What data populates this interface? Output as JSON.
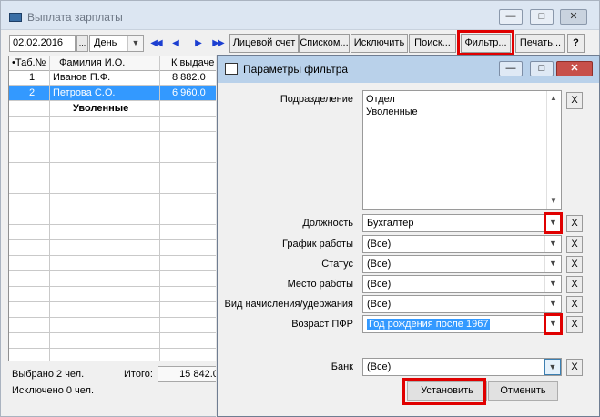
{
  "main_window": {
    "title": "Выплата зарплаты",
    "caption": {
      "minimize": "—",
      "maximize": "□",
      "close": "✕"
    },
    "toolbar": {
      "date_value": "02.02.2016",
      "ellipsis": "...",
      "period_value": "День",
      "nav": [
        "◀◀",
        "◀",
        "▶",
        "▶▶"
      ],
      "buttons": [
        "Лицевой счет",
        "Списком...",
        "Исключить",
        "Поиск...",
        "Фильтр...",
        "Печать...",
        "?"
      ]
    },
    "grid": {
      "columns": [
        "•Таб.№",
        "Фамилия И.О.",
        "К выдаче"
      ],
      "rows": [
        {
          "num": "1",
          "name": "Иванов П.Ф.",
          "amount": "8 882.0"
        },
        {
          "num": "2",
          "name": "Петрова С.О.",
          "amount": "6 960.0"
        }
      ],
      "group_label": "Уволенные"
    },
    "footer": {
      "selected": "Выбрано 2 чел.",
      "excluded": "Исключено 0 чел.",
      "total_label": "Итого:",
      "total_value": "15 842.00"
    }
  },
  "filter_dialog": {
    "title": "Параметры фильтра",
    "caption": {
      "minimize": "—",
      "maximize": "□",
      "close": "✕"
    },
    "fields": {
      "department": {
        "label": "Подразделение",
        "items": [
          "Отдел",
          "Уволенные"
        ]
      },
      "position": {
        "label": "Должность",
        "value": "Бухгалтер"
      },
      "schedule": {
        "label": "График работы",
        "value": "(Все)"
      },
      "status": {
        "label": "Статус",
        "value": "(Все)"
      },
      "workplace": {
        "label": "Место работы",
        "value": "(Все)"
      },
      "accrual_type": {
        "label": "Вид начисления/удержания",
        "value": "(Все)"
      },
      "pension_age": {
        "label": "Возраст ПФР",
        "value": "Год рождения после 1967"
      },
      "bank": {
        "label": "Банк",
        "value": "(Все)"
      }
    },
    "clear_label": "X",
    "apply_label": "Установить",
    "cancel_label": "Отменить"
  },
  "colors": {
    "highlight_box": "#e00000",
    "selection": "#3399ff",
    "nav_arrows": "#1c3fd1"
  }
}
